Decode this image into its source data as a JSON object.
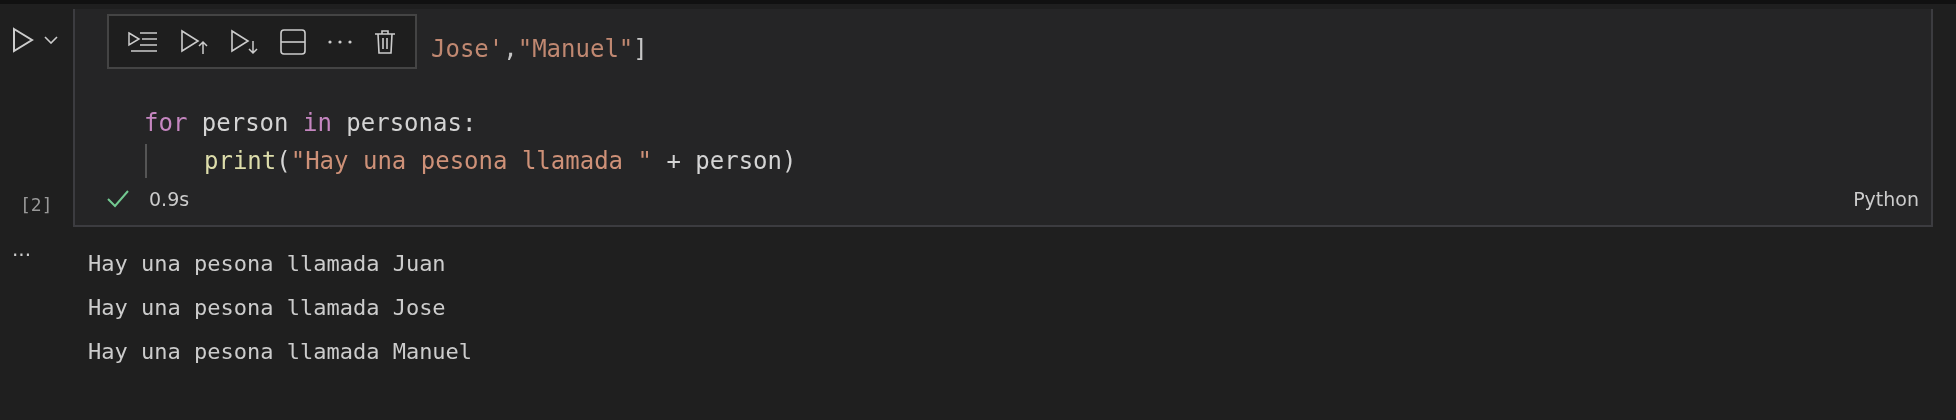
{
  "cell": {
    "execution_count": "[2]",
    "code_lines": [
      {
        "kind": "code",
        "indent": false,
        "partial": true,
        "tokens": [
          {
            "kind": "string",
            "text": "Jose'"
          },
          {
            "kind": "plain",
            "text": ","
          },
          {
            "kind": "string",
            "text": "\"Manuel\""
          },
          {
            "kind": "plain",
            "text": "]"
          }
        ]
      },
      {
        "kind": "blank"
      },
      {
        "kind": "code",
        "indent": false,
        "partial": false,
        "tokens": [
          {
            "kind": "keyword",
            "text": "for"
          },
          {
            "kind": "plain",
            "text": " person "
          },
          {
            "kind": "keyword",
            "text": "in"
          },
          {
            "kind": "plain",
            "text": " personas:"
          }
        ]
      },
      {
        "kind": "code",
        "indent": true,
        "partial": false,
        "tokens": [
          {
            "kind": "function",
            "text": "print"
          },
          {
            "kind": "plain",
            "text": "("
          },
          {
            "kind": "string",
            "text": "\"Hay una pesona llamada \""
          },
          {
            "kind": "plain",
            "text": " + person)"
          }
        ]
      }
    ],
    "status": {
      "success": true,
      "duration": "0.9s"
    },
    "language": "Python"
  },
  "output": {
    "more": "···",
    "lines": [
      "Hay una pesona llamada Juan",
      "Hay una pesona llamada Jose",
      "Hay una pesona llamada Manuel"
    ]
  }
}
